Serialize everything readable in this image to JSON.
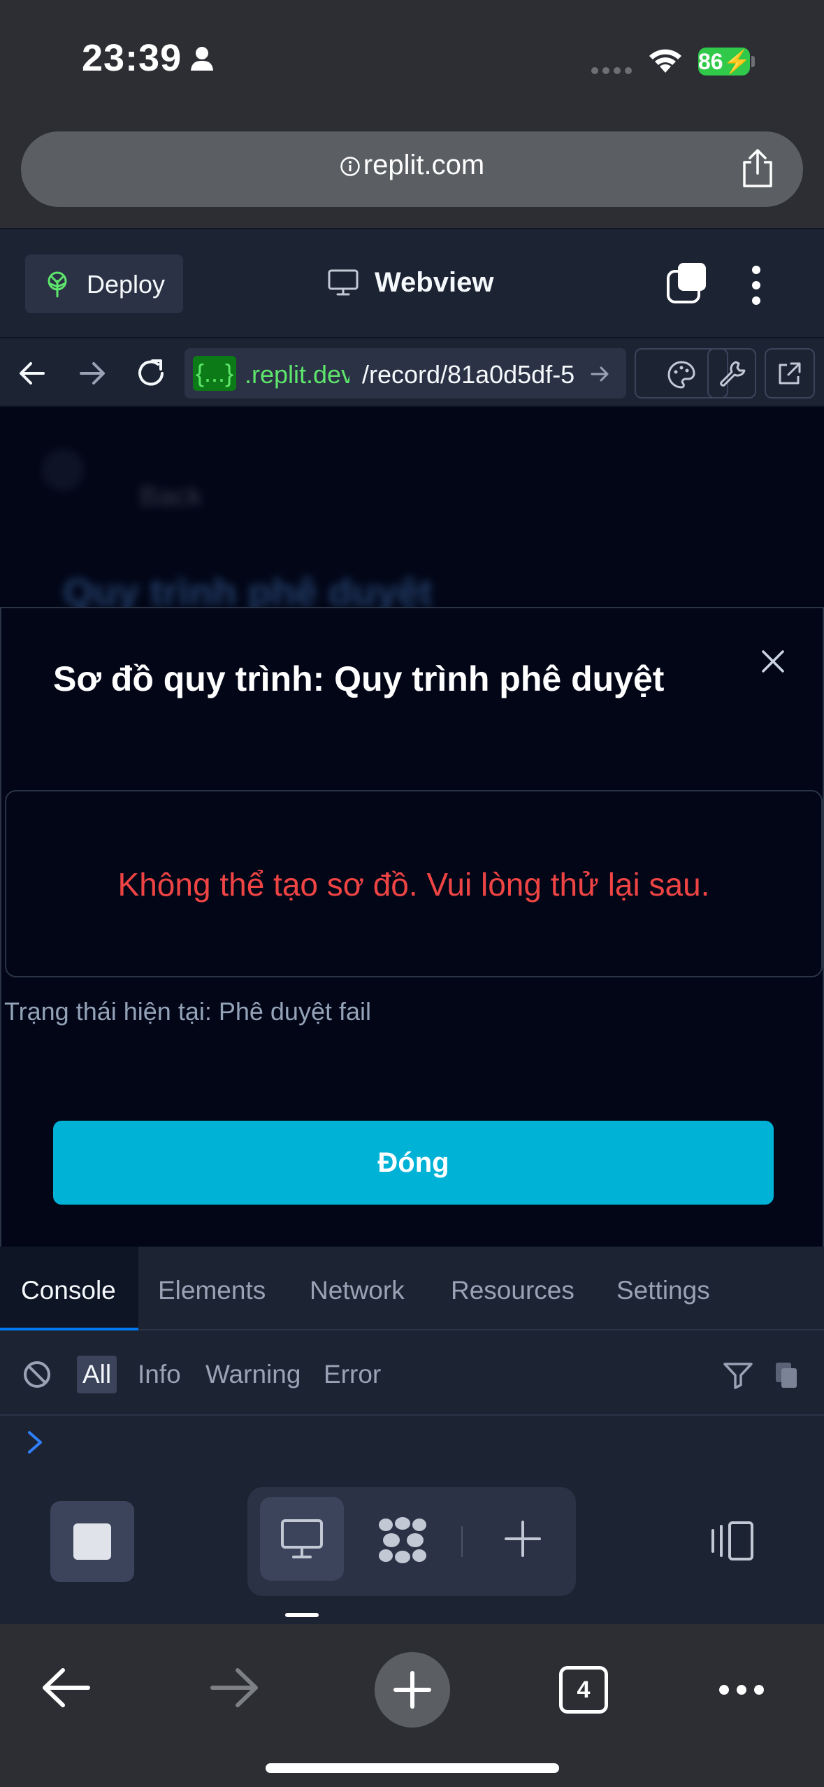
{
  "status_bar": {
    "time": "23:39",
    "battery": "86"
  },
  "browser": {
    "url_domain": "replit.com"
  },
  "replit_header": {
    "deploy_label": "Deploy",
    "webview_label": "Webview"
  },
  "webview_nav": {
    "url_tag": "{...}",
    "url_domain": ".replit.dev",
    "url_path": "/record/81a0d5df-5"
  },
  "page_behind": {
    "breadcrumb": "Back",
    "heading": "Quy trình phê duyệt"
  },
  "modal": {
    "title": "Sơ đồ quy trình: Quy trình phê duyệt",
    "error_message": "Không thể tạo sơ đồ. Vui lòng thử lại sau.",
    "status_line": "Trạng thái hiện tại: Phê duyệt fail",
    "close_button": "Đóng"
  },
  "devtools": {
    "tabs": [
      "Console",
      "Elements",
      "Network",
      "Resources",
      "Settings"
    ],
    "active_tab": "Console",
    "levels": [
      "All",
      "Info",
      "Warning",
      "Error"
    ],
    "active_level": "All"
  },
  "safari_bottom": {
    "tab_count": "4"
  },
  "colors": {
    "accent_cyan": "#00b2d6",
    "error_red": "#ef4444",
    "replit_green": "#5ee56c",
    "battery_green": "#30c94a",
    "devtools_active": "#0079f2"
  }
}
